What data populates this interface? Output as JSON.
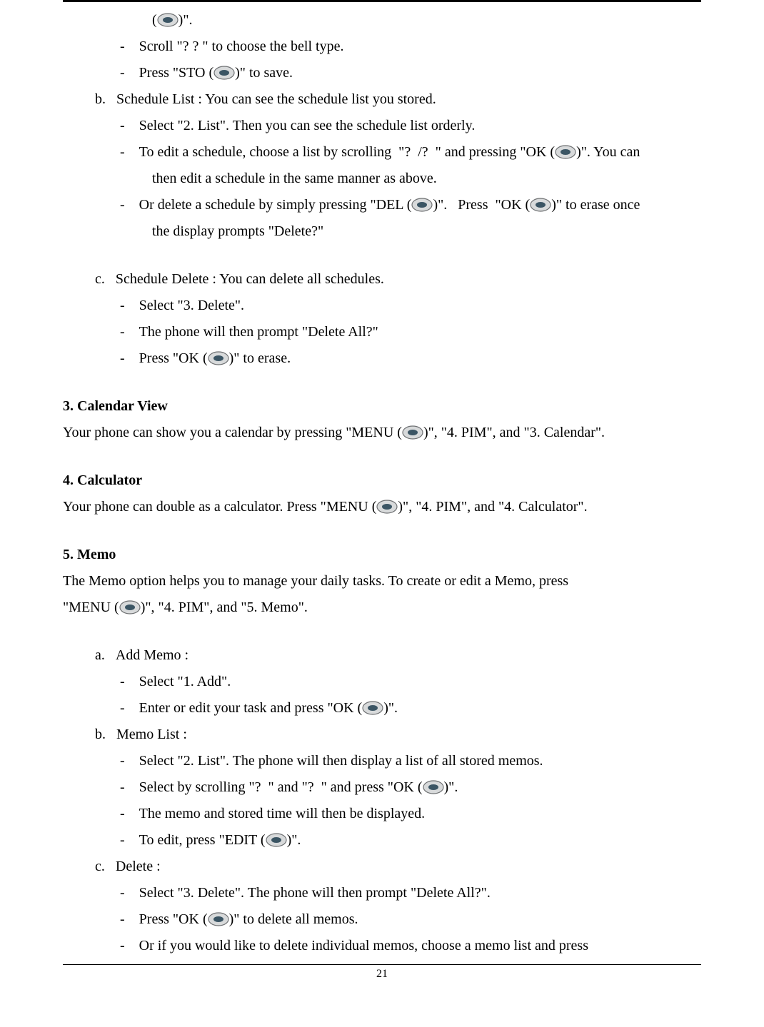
{
  "page_number": "21",
  "fragment_top": "(        )\".",
  "top_dashes": [
    "Scroll \"?   ?  \" to choose the bell type.",
    "Press \"STO (        )\" to save."
  ],
  "b_head": "Schedule List : You can see the schedule list you stored.",
  "b_items": [
    "Select \"2. List\". Then you can see the schedule list orderly.",
    "To edit a schedule, choose a list by scrolling  \"?  /?  \" and pressing \"OK (        )\". You can",
    "then edit a schedule in the same manner as above.",
    "Or delete a schedule by simply pressing \"DEL (        )\".   Press  \"OK (        )\" to erase once",
    "the display prompts \"Delete?\""
  ],
  "c_head": "Schedule Delete : You can delete all schedules.",
  "c_items": [
    "Select \"3. Delete\".",
    "The phone will then prompt \"Delete All?\"",
    "Press \"OK (        )\" to erase."
  ],
  "sec3": {
    "title": "3.   Calendar View",
    "body": "Your phone can show you a calendar by pressing \"MENU (        )\", \"4. PIM\", and \"3. Calendar\"."
  },
  "sec4": {
    "title": "4.   Calculator",
    "body": "Your phone can double as a calculator. Press \"MENU (        )\", \"4. PIM\", and \"4. Calculator\"."
  },
  "sec5": {
    "title": "5.   Memo",
    "body1": "The Memo option helps you to manage your daily tasks.  To create or edit a Memo, press",
    "body2": "\"MENU (        )\", \"4. PIM\", and \"5. Memo\"."
  },
  "memo_a": {
    "head": "Add Memo :",
    "items": [
      "Select \"1. Add\".",
      "Enter or edit your task and press \"OK (        )\"."
    ]
  },
  "memo_b": {
    "head": "Memo List :",
    "items": [
      "Select \"2. List\". The phone will then display a list of all stored memos.",
      "Select by scrolling \"?  \" and \"?  \" and press \"OK (        )\".",
      "The memo and stored time will then be displayed.",
      "To edit, press \"EDIT (        )\"."
    ]
  },
  "memo_c": {
    "head": "Delete :",
    "items": [
      "Select \"3. Delete\". The phone will then prompt \"Delete All?\".",
      "Press \"OK (        )\" to delete all memos.",
      "Or if you would like to delete individual memos, choose a memo list and press"
    ]
  }
}
